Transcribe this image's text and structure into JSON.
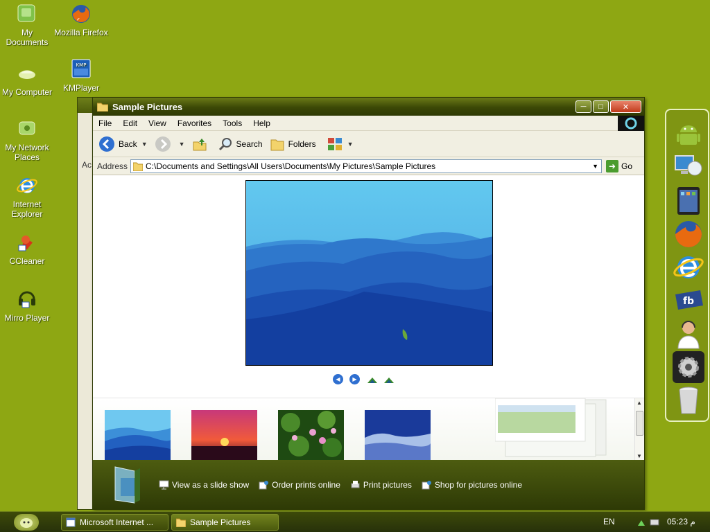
{
  "desktop": {
    "icons": [
      {
        "label": "My Documents"
      },
      {
        "label": "Mozilla Firefox"
      },
      {
        "label": "My Computer"
      },
      {
        "label": "KMPlayer"
      },
      {
        "label": "My Network Places"
      },
      {
        "label": "Internet Explorer"
      },
      {
        "label": "CCleaner"
      },
      {
        "label": "Mirro Player"
      }
    ]
  },
  "background_window": {
    "fragment": "Ac"
  },
  "window": {
    "title": "Sample Pictures",
    "menu": [
      "File",
      "Edit",
      "View",
      "Favorites",
      "Tools",
      "Help"
    ],
    "toolbar": {
      "back": "Back",
      "search": "Search",
      "folders": "Folders"
    },
    "address": {
      "label": "Address",
      "path": "C:\\Documents and Settings\\All Users\\Documents\\My Pictures\\Sample Pictures",
      "go": "Go"
    },
    "tasks": [
      {
        "label": "View as a slide show"
      },
      {
        "label": "Order prints online"
      },
      {
        "label": "Print pictures"
      },
      {
        "label": "Shop for pictures online"
      }
    ]
  },
  "taskbar": {
    "buttons": [
      {
        "label": "Microsoft Internet ..."
      },
      {
        "label": "Sample Pictures"
      }
    ],
    "language": "EN",
    "clock": "05:23 م"
  },
  "colors": {
    "desktop": "#8ea713",
    "titlebar": "#3b4706",
    "tasks_panel": "#3a4808"
  }
}
